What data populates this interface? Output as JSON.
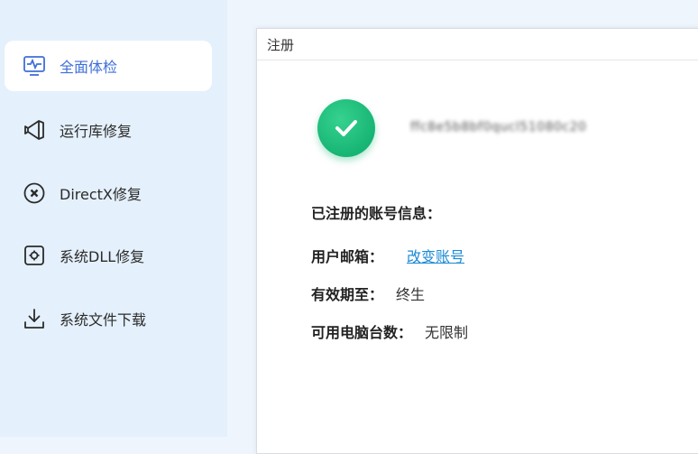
{
  "sidebar": {
    "items": [
      {
        "label": "全面体检",
        "icon": "monitor-pulse-icon",
        "active": true
      },
      {
        "label": "运行库修复",
        "icon": "visual-studio-icon",
        "active": false
      },
      {
        "label": "DirectX修复",
        "icon": "circle-x-icon",
        "active": false
      },
      {
        "label": "系统DLL修复",
        "icon": "dll-gear-icon",
        "active": false
      },
      {
        "label": "系统文件下载",
        "icon": "download-icon",
        "active": false
      }
    ],
    "active_color": "#3f6fd8"
  },
  "dialog": {
    "title": "注册",
    "user_id": "ffc8e5b8bf0qucl51080c20",
    "heading": "已注册的账号信息：",
    "email_label": "用户邮箱：",
    "change_account_link": "改变账号",
    "validity_label": "有效期至：",
    "validity_value": "终生",
    "devices_label": "可用电脑台数：",
    "devices_value": "无限制"
  },
  "colors": {
    "success_green": "#17b574",
    "link_blue": "#1a8ad6"
  }
}
